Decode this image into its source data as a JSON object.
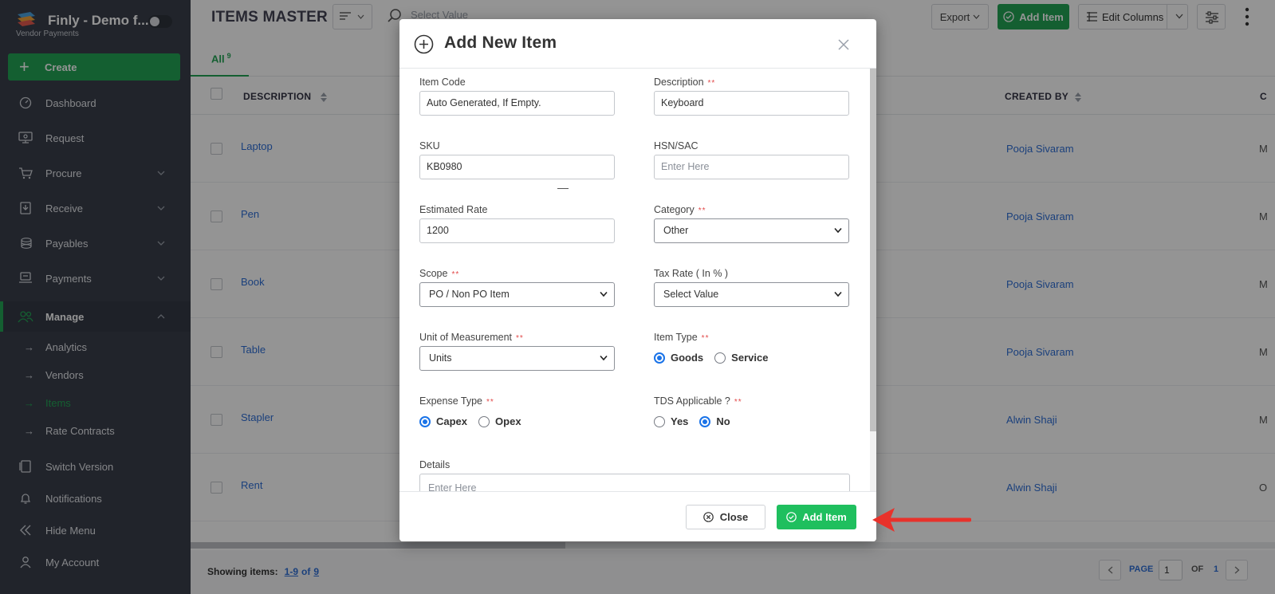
{
  "sidebar": {
    "brand_title": "Finly - Demo f...",
    "brand_sub": "Vendor Payments",
    "create_label": "Create",
    "items": [
      {
        "label": "Dashboard",
        "icon": "dashboard-icon"
      },
      {
        "label": "Request",
        "icon": "request-icon"
      },
      {
        "label": "Procure",
        "icon": "cart-icon"
      },
      {
        "label": "Receive",
        "icon": "receive-icon"
      },
      {
        "label": "Payables",
        "icon": "coins-icon"
      },
      {
        "label": "Payments",
        "icon": "payments-icon"
      },
      {
        "label": "Manage",
        "icon": "users-icon"
      }
    ],
    "manage_sub": [
      "Analytics",
      "Vendors",
      "Items",
      "Rate Contracts"
    ],
    "bottom": [
      "Switch Version",
      "Notifications",
      "Hide Menu",
      "My Account"
    ]
  },
  "main": {
    "page_title": "ITEMS MASTER",
    "select_value": "Select Value",
    "export_label": "Export",
    "add_item_label": "Add Item",
    "edit_columns_label": "Edit Columns",
    "tab_all": "All",
    "tab_all_count": "9",
    "columns": {
      "description": "DESCRIPTION",
      "created_by": "CREATED BY",
      "trailing": "C"
    },
    "rows": [
      {
        "description": "Laptop",
        "created_by": "Pooja Sivaram",
        "trail": "M"
      },
      {
        "description": "Pen",
        "created_by": "Pooja Sivaram",
        "trail": "M"
      },
      {
        "description": "Book",
        "created_by": "Pooja Sivaram",
        "trail": "M"
      },
      {
        "description": "Table",
        "created_by": "Pooja Sivaram",
        "trail": "M"
      },
      {
        "description": "Stapler",
        "created_by": "Alwin Shaji",
        "trail": "M"
      },
      {
        "description": "Rent",
        "created_by": "Alwin Shaji",
        "trail": "O"
      }
    ],
    "footer": {
      "showing_label": "Showing items:",
      "range": "1-9",
      "of": "of",
      "total": "9",
      "page_label": "PAGE",
      "page_value": "1",
      "of_label": "OF",
      "page_total": "1"
    }
  },
  "modal": {
    "title": "Add New Item",
    "item_code_label": "Item Code",
    "item_code_placeholder": "Auto Generated, If Empty.",
    "description_label": "Description",
    "description_value": "Keyboard",
    "sku_label": "SKU",
    "sku_value": "KB0980",
    "hsn_label": "HSN/SAC",
    "hsn_placeholder": "Enter Here",
    "rate_label": "Estimated Rate",
    "rate_value": "1200",
    "category_label": "Category",
    "category_value": "Other",
    "scope_label": "Scope",
    "scope_value": "PO / Non PO Item",
    "tax_label": "Tax Rate ( In % )",
    "tax_value": "Select Value",
    "uom_label": "Unit of Measurement",
    "uom_value": "Units",
    "item_type_label": "Item Type",
    "item_type_options": [
      "Goods",
      "Service"
    ],
    "item_type_selected": "Goods",
    "expense_label": "Expense Type",
    "expense_options": [
      "Capex",
      "Opex"
    ],
    "expense_selected": "Capex",
    "tds_label": "TDS Applicable ?",
    "tds_options": [
      "Yes",
      "No"
    ],
    "tds_selected": "No",
    "details_label": "Details",
    "details_placeholder": "Enter Here",
    "required_mark": "**",
    "close_label": "Close",
    "add_label": "Add Item"
  },
  "colors": {
    "sidebar_bg": "#3a3f4b",
    "accent_green": "#23a455",
    "link_blue": "#2f6fd6",
    "radio_blue": "#1a73e8",
    "annotation_red": "#e8322b"
  }
}
